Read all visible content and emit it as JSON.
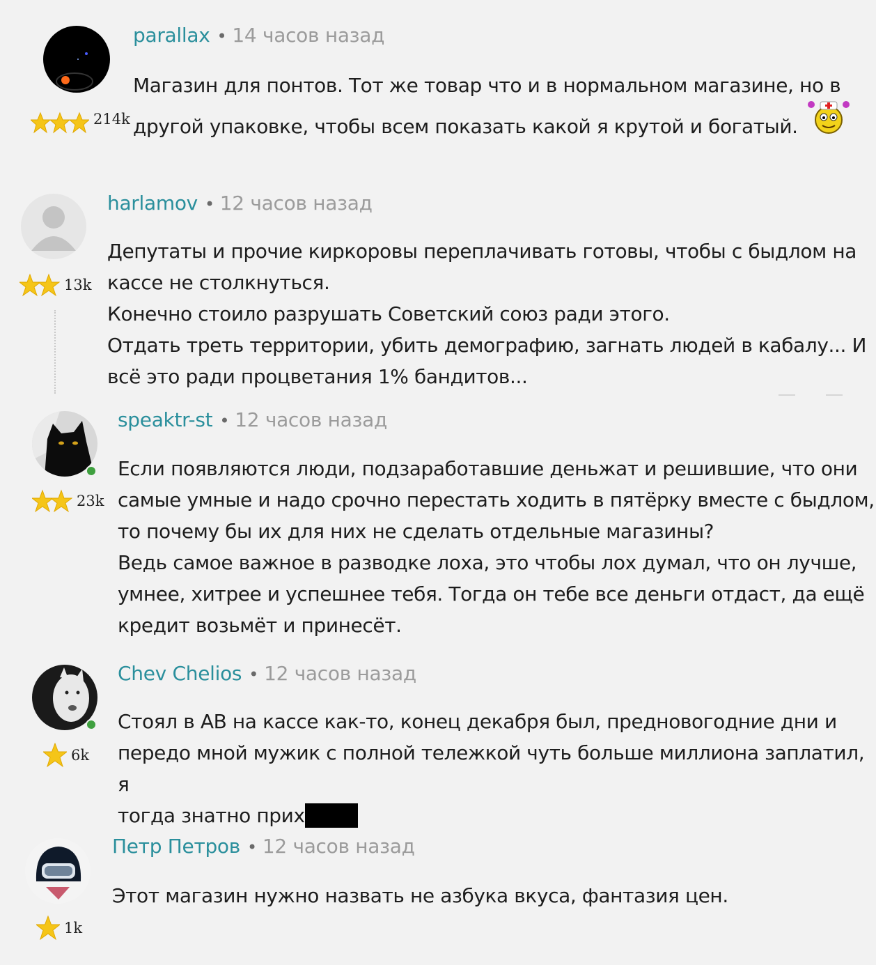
{
  "comments": [
    {
      "author": "parallax",
      "time": "14 часов назад",
      "rating": "214k",
      "stars": 3,
      "lines": [
        "Магазин для понтов. Тот же товар что и в нормальном магазине, но в",
        "другой упаковке, чтобы всем показать какой я крутой и богатый."
      ],
      "emoji": "nurse-smiley-icon"
    },
    {
      "author": "harlamov",
      "time": "12 часов назад",
      "rating": "13k",
      "stars": 2,
      "lines": [
        "Депутаты и прочие киркоровы переплачивать готовы, чтобы с быдлом на",
        "кассе не столкнуться.",
        "Конечно стоило разрушать Советский союз ради этого.",
        "Отдать треть территории, убить демографию, загнать людей в кабалу... И",
        "всё это ради процветания 1% бандитов..."
      ]
    },
    {
      "author": "speaktr-st",
      "time": "12 часов назад",
      "rating": "23k",
      "stars": 2,
      "online": true,
      "lines": [
        "Если появляются люди, подзаработавшие деньжат и решившие, что они",
        "самые умные и надо срочно перестать ходить в пятёрку вместе с быдлом,",
        "то почему бы их для них не сделать отдельные магазины?",
        "Ведь самое важное в разводке лоха, это чтобы лох думал, что он лучше,",
        "умнее, хитрее и успешнее тебя. Тогда он тебе все деньги отдаст, да ещё",
        "кредит возьмёт и принесёт."
      ]
    },
    {
      "author": "Chev Chelios",
      "time": "12 часов назад",
      "rating": "6k",
      "stars": 1,
      "online": true,
      "lines": [
        "Стоял в АВ на кассе как-то, конец декабря был, предновогодние дни и",
        "передо мной мужик с полной тележкой чуть больше миллиона заплатил, я",
        "тогда знатно прих"
      ]
    },
    {
      "author": "Петр Петров",
      "time": "12 часов назад",
      "rating": "1k",
      "stars": 1,
      "lines": [
        "Этот магазин нужно назвать не азбука вкуса, фантазия цен."
      ]
    }
  ],
  "colors": {
    "background": "#f2f2f2",
    "author": "#2a8f9c",
    "time": "#9b9b9b",
    "star": "#f5c518",
    "online": "#3fa03f"
  }
}
